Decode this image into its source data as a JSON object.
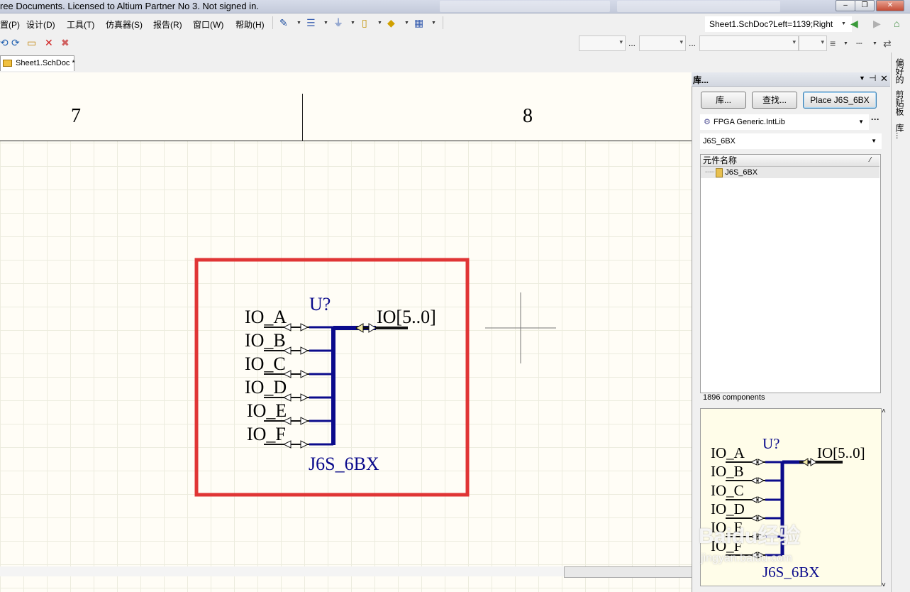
{
  "window": {
    "title": "ree Documents. Licensed to Altium Partner No 3. Not signed in.",
    "address": "Sheet1.SchDoc?Left=1139;Right"
  },
  "menu": [
    "置(P)",
    "设计(D)",
    "工具(T)",
    "仿真器(S)",
    "报告(R)",
    "窗口(W)",
    "帮助(H)"
  ],
  "toolbar2": {
    "ellipsis1": "...",
    "ellipsis2": "..."
  },
  "document_tab": {
    "label": "Sheet1.SchDoc *"
  },
  "sheet": {
    "zones": [
      "7",
      "8"
    ],
    "component": {
      "designator": "U?",
      "comment": "J6S_6BX",
      "bus_label": "IO[5..0]",
      "pins": [
        "IO_A",
        "IO_B",
        "IO_C",
        "IO_D",
        "IO_E",
        "IO_F"
      ]
    },
    "highlight_color": "#e03030",
    "wire_color": "#0b0b8c"
  },
  "library_panel": {
    "title": "库...",
    "buttons": {
      "library": "库...",
      "search": "查找...",
      "place": "Place J6S_6BX"
    },
    "library_name": "FPGA Generic.IntLib",
    "filter": "J6S_6BX",
    "column_header": "元件名称",
    "items": [
      "J6S_6BX"
    ],
    "component_count": "1896 components"
  },
  "side_tabs": [
    "偏好的",
    "剪贴板",
    "库..."
  ],
  "watermark": {
    "main": "Baidu经验",
    "sub": "jingyan.baidu.com"
  }
}
